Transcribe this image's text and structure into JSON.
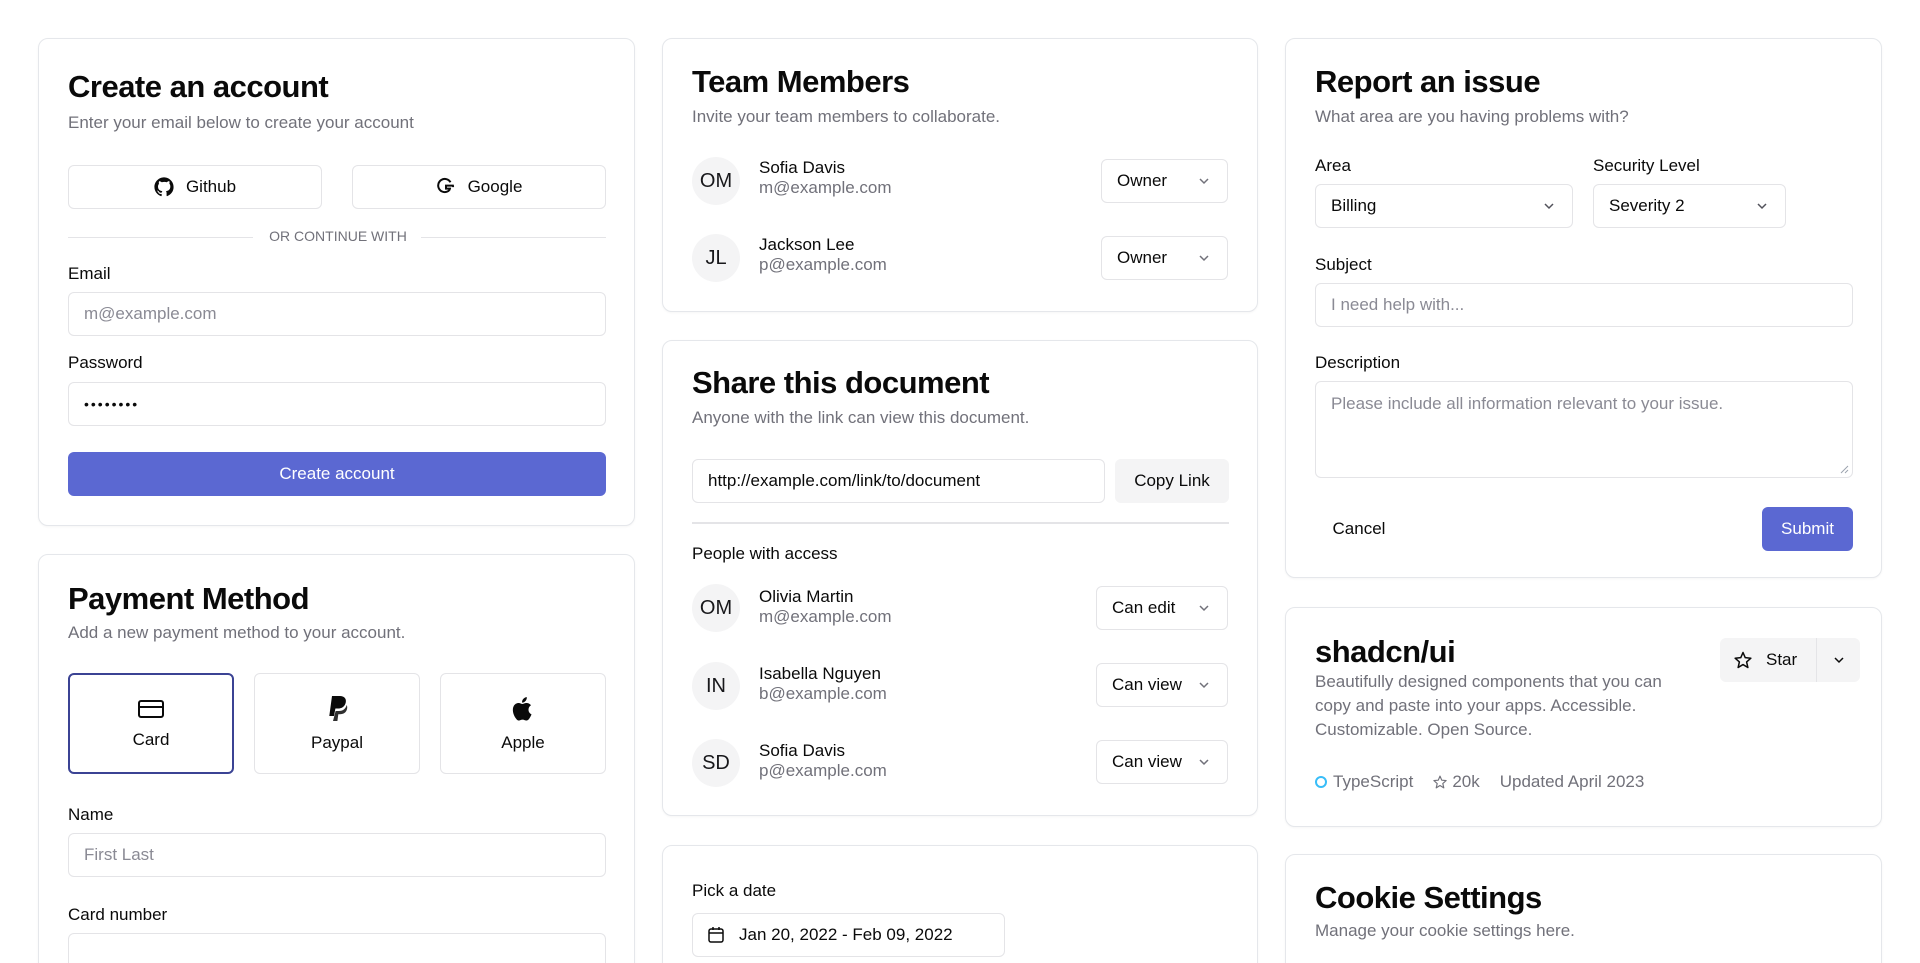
{
  "create_account": {
    "title": "Create an account",
    "description": "Enter your email below to create your account",
    "github_label": "Github",
    "google_label": "Google",
    "divider_text": "OR CONTINUE WITH",
    "email_label": "Email",
    "email_placeholder": "m@example.com",
    "password_label": "Password",
    "password_value": "••••••••",
    "submit_label": "Create account"
  },
  "payment": {
    "title": "Payment Method",
    "description": "Add a new payment method to your account.",
    "methods": [
      {
        "label": "Card",
        "icon": "credit-card-icon",
        "selected": true
      },
      {
        "label": "Paypal",
        "icon": "paypal-icon",
        "selected": false
      },
      {
        "label": "Apple",
        "icon": "apple-icon",
        "selected": false
      }
    ],
    "name_label": "Name",
    "name_placeholder": "First Last",
    "card_number_label": "Card number"
  },
  "team": {
    "title": "Team Members",
    "description": "Invite your team members to collaborate.",
    "members": [
      {
        "initials": "OM",
        "name": "Sofia Davis",
        "email": "m@example.com",
        "role": "Owner"
      },
      {
        "initials": "JL",
        "name": "Jackson Lee",
        "email": "p@example.com",
        "role": "Owner"
      }
    ]
  },
  "share": {
    "title": "Share this document",
    "description": "Anyone with the link can view this document.",
    "link_value": "http://example.com/link/to/document",
    "copy_label": "Copy Link",
    "people_heading": "People with access",
    "people": [
      {
        "initials": "OM",
        "name": "Olivia Martin",
        "email": "m@example.com",
        "permission": "Can edit"
      },
      {
        "initials": "IN",
        "name": "Isabella Nguyen",
        "email": "b@example.com",
        "permission": "Can view"
      },
      {
        "initials": "SD",
        "name": "Sofia Davis",
        "email": "p@example.com",
        "permission": "Can view"
      }
    ]
  },
  "date_picker": {
    "label": "Pick a date",
    "value": "Jan 20, 2022 - Feb 09, 2022"
  },
  "report": {
    "title": "Report an issue",
    "description": "What area are you having problems with?",
    "area_label": "Area",
    "area_value": "Billing",
    "security_label": "Security Level",
    "security_value": "Severity 2",
    "subject_label": "Subject",
    "subject_placeholder": "I need help with...",
    "description_label": "Description",
    "description_placeholder": "Please include all information relevant to your issue.",
    "cancel_label": "Cancel",
    "submit_label": "Submit"
  },
  "repo": {
    "title": "shadcn/ui",
    "description": "Beautifully designed components that you can copy and paste into your apps. Accessible. Customizable. Open Source.",
    "star_label": "Star",
    "language": "TypeScript",
    "stars": "20k",
    "updated": "Updated April 2023"
  },
  "cookie": {
    "title": "Cookie Settings",
    "description": "Manage your cookie settings here."
  },
  "colors": {
    "primary": "#5b68d2",
    "border": "#e4e4e7",
    "muted_text": "#71717a",
    "language_dot": "#38bdf8"
  }
}
